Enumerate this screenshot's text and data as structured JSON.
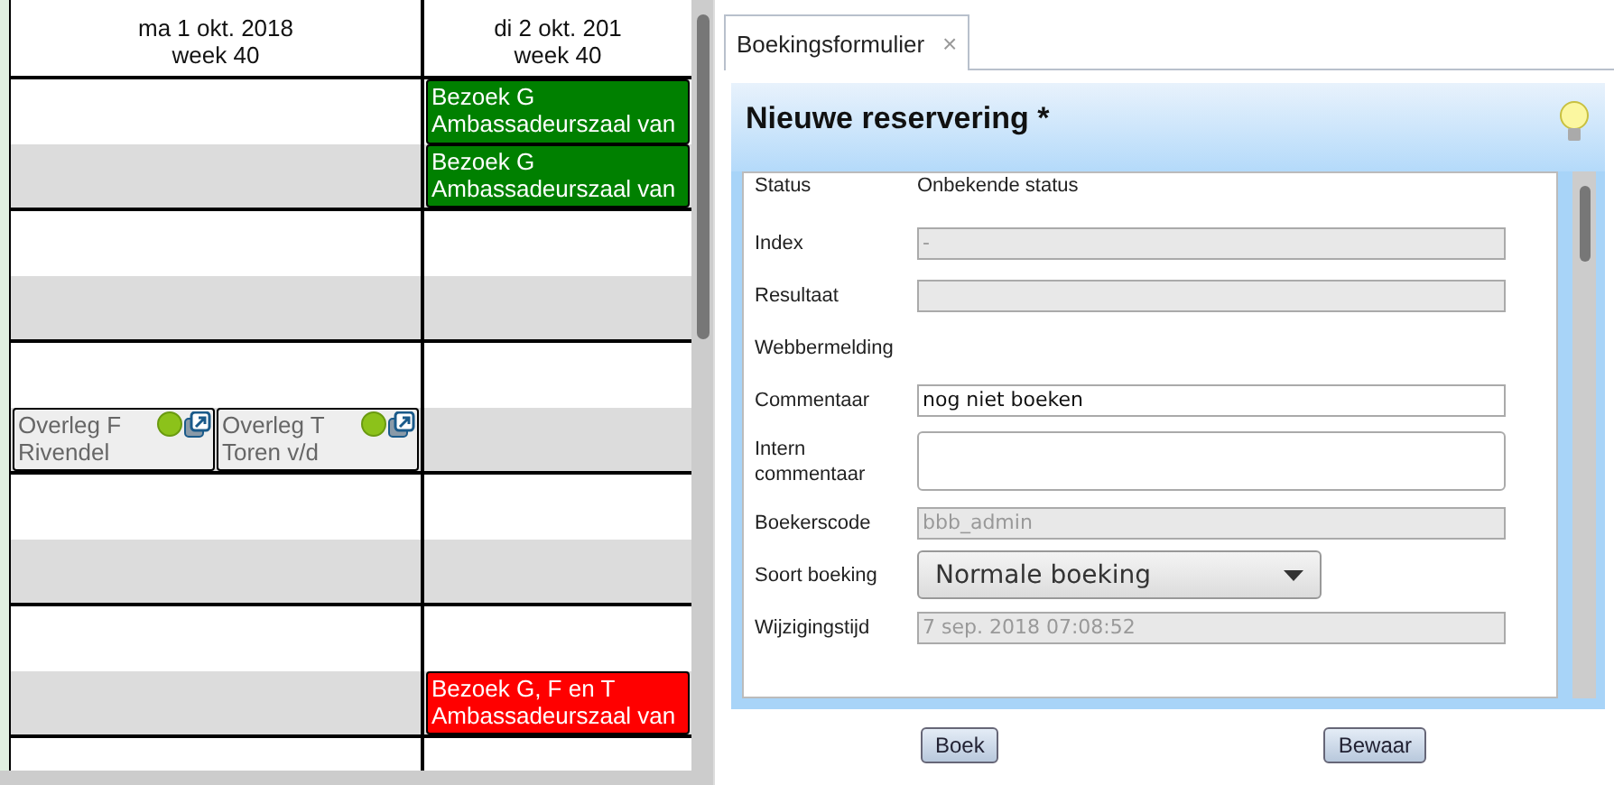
{
  "calendar": {
    "days": [
      {
        "date": "ma 1 okt. 2018",
        "week": "week 40"
      },
      {
        "date": "di 2 okt. 201",
        "week": "week 40"
      }
    ],
    "slots": [
      {
        "shaded": false,
        "day_2": [
          {
            "kind": "visit",
            "title": "Bezoek G",
            "location": "Ambassadeurszaal van",
            "color": "#008000"
          }
        ]
      },
      {
        "shaded": true,
        "day_2": [
          {
            "kind": "visit",
            "title": "Bezoek G",
            "location": "Ambassadeurszaal van",
            "color": "#008000"
          }
        ]
      },
      {
        "shaded": false
      },
      {
        "shaded": true
      },
      {
        "shaded": false
      },
      {
        "shaded": true,
        "day_1": [
          {
            "kind": "meeting",
            "title": "Overleg F",
            "location": "Rivendel",
            "color": "#eeeeee"
          },
          {
            "kind": "meeting",
            "title": "Overleg T",
            "location": "Toren v/d",
            "color": "#eeeeee"
          }
        ]
      },
      {
        "shaded": false
      },
      {
        "shaded": true
      },
      {
        "shaded": false
      },
      {
        "shaded": true,
        "day_2": [
          {
            "kind": "visit",
            "title": "Bezoek G, F en T",
            "location": "Ambassadeurszaal van",
            "color": "#ff0000"
          }
        ]
      },
      {
        "shaded": false
      }
    ]
  },
  "tabs": [
    {
      "label": "Boekingsformulier",
      "close": "×",
      "selected": true
    }
  ],
  "form": {
    "title": "Nieuwe reservering *",
    "fields": [
      {
        "kind": "text",
        "label": "Status",
        "value": "Onbekende status"
      },
      {
        "kind": "input",
        "label": "Index",
        "value": "-",
        "disabled": true
      },
      {
        "kind": "input",
        "label": "Resultaat",
        "disabled": true
      },
      {
        "kind": "none",
        "label": "Webbermelding"
      },
      {
        "kind": "input",
        "label": "Commentaar",
        "value": "nog niet boeken",
        "disabled": false
      },
      {
        "kind": "textarea",
        "label": "Intern commentaar"
      },
      {
        "kind": "input",
        "label": "Boekerscode",
        "value": "bbb_admin",
        "disabled": true
      },
      {
        "kind": "select",
        "label": "Soort boeking",
        "value": "Normale boeking"
      },
      {
        "kind": "input",
        "label": "Wijzigingstijd",
        "value": "7 sep. 2018 07:08:52",
        "disabled": true
      }
    ],
    "buttons": [
      "Boek",
      "Bewaar"
    ]
  }
}
